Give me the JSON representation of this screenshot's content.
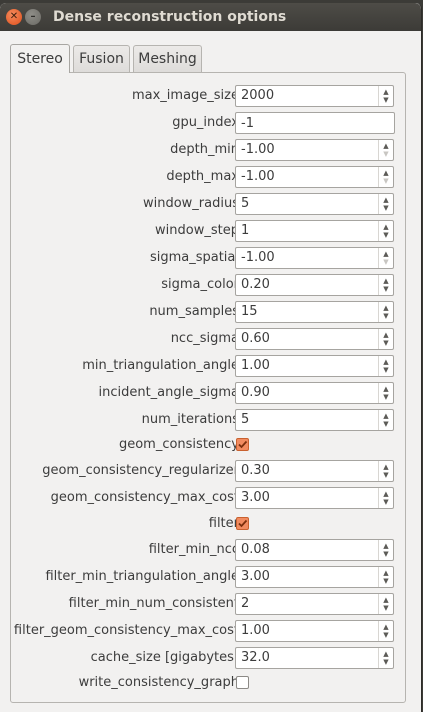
{
  "window": {
    "title": "Dense reconstruction options"
  },
  "tabs": [
    {
      "label": "Stereo",
      "active": true
    },
    {
      "label": "Fusion",
      "active": false
    },
    {
      "label": "Meshing",
      "active": false
    }
  ],
  "fields": [
    {
      "label": "max_image_size",
      "type": "spin",
      "value": "2000"
    },
    {
      "label": "gpu_index",
      "type": "text",
      "value": "-1"
    },
    {
      "label": "depth_min",
      "type": "spin",
      "value": "-1.00",
      "down_disabled": true
    },
    {
      "label": "depth_max",
      "type": "spin",
      "value": "-1.00",
      "down_disabled": true
    },
    {
      "label": "window_radius",
      "type": "spin",
      "value": "5"
    },
    {
      "label": "window_step",
      "type": "spin",
      "value": "1"
    },
    {
      "label": "sigma_spatial",
      "type": "spin",
      "value": "-1.00",
      "down_disabled": true
    },
    {
      "label": "sigma_color",
      "type": "spin",
      "value": "0.20"
    },
    {
      "label": "num_samples",
      "type": "spin",
      "value": "15"
    },
    {
      "label": "ncc_sigma",
      "type": "spin",
      "value": "0.60"
    },
    {
      "label": "min_triangulation_angle",
      "type": "spin",
      "value": "1.00"
    },
    {
      "label": "incident_angle_sigma",
      "type": "spin",
      "value": "0.90"
    },
    {
      "label": "num_iterations",
      "type": "spin",
      "value": "5"
    },
    {
      "label": "geom_consistency",
      "type": "check",
      "checked": true
    },
    {
      "label": "geom_consistency_regularizer",
      "type": "spin",
      "value": "0.30"
    },
    {
      "label": "geom_consistency_max_cost",
      "type": "spin",
      "value": "3.00"
    },
    {
      "label": "filter",
      "type": "check",
      "checked": true
    },
    {
      "label": "filter_min_ncc",
      "type": "spin",
      "value": "0.08"
    },
    {
      "label": "filter_min_triangulation_angle",
      "type": "spin",
      "value": "3.00"
    },
    {
      "label": "filter_min_num_consistent",
      "type": "spin",
      "value": "2"
    },
    {
      "label": "filter_geom_consistency_max_cost",
      "type": "spin",
      "value": "1.00"
    },
    {
      "label": "cache_size [gigabytes]",
      "type": "spin",
      "value": "32.0"
    },
    {
      "label": "write_consistency_graph",
      "type": "check",
      "checked": false
    }
  ],
  "colors": {
    "accent": "#f18b60",
    "titlebar": "#3c3b37",
    "panel": "#f2f1f0"
  }
}
